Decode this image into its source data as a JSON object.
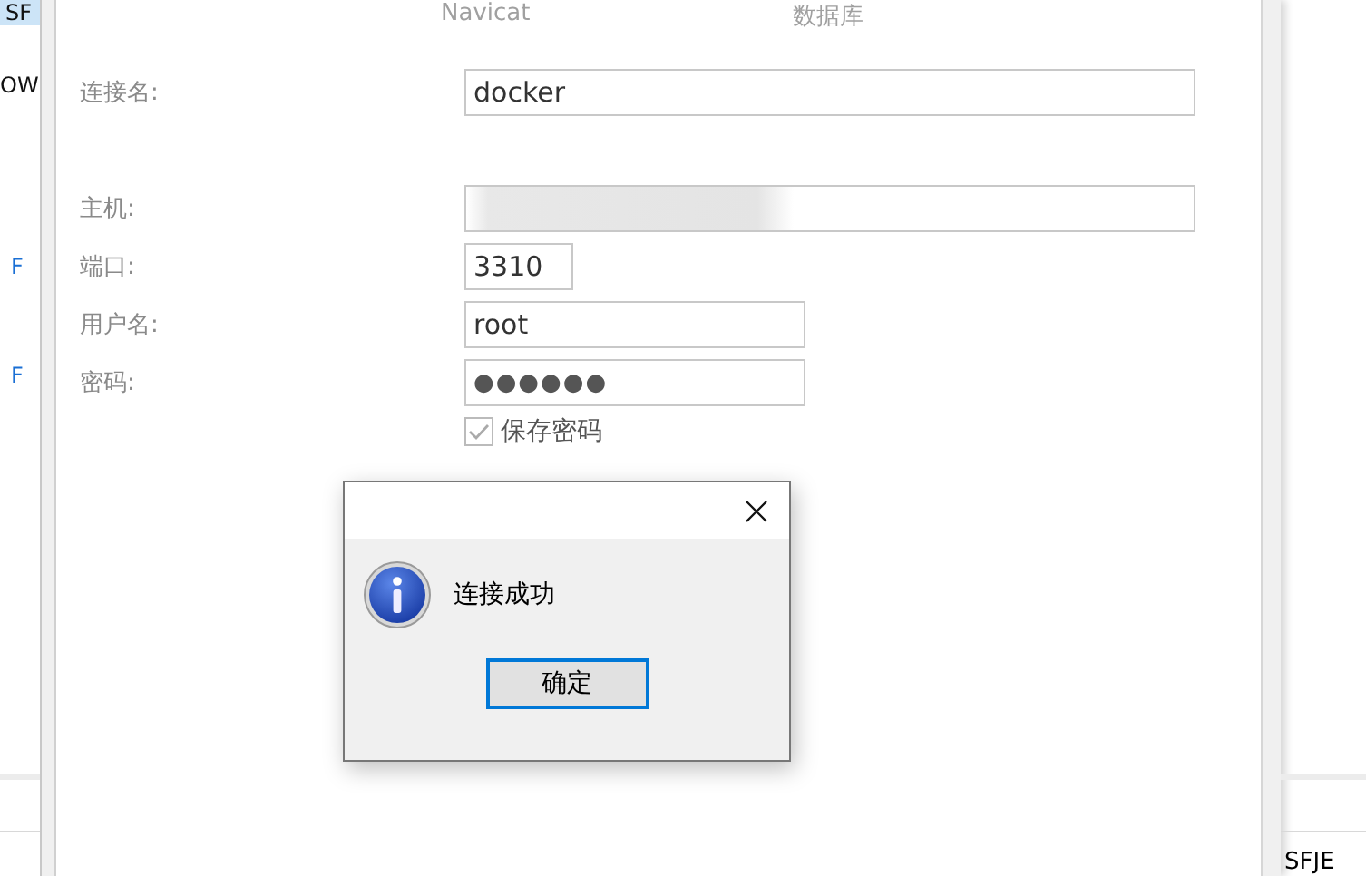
{
  "background_left": {
    "items": [
      {
        "text": "SF",
        "kind": "plain",
        "selected": true
      },
      {
        "text": "OW",
        "kind": "plain",
        "selected": false
      },
      {
        "text": "F",
        "kind": "link",
        "selected": false
      },
      {
        "text": "F",
        "kind": "link",
        "selected": false
      }
    ]
  },
  "background_right": {
    "items": [
      {
        "text": "SFJE"
      }
    ]
  },
  "connection_dialog": {
    "tabs": [
      {
        "label": "Navicat"
      },
      {
        "label": "数据库"
      }
    ],
    "fields": [
      {
        "label": "连接名:",
        "value": "docker",
        "kind": "text"
      },
      {
        "label": "主机:",
        "kind": "redacted"
      },
      {
        "label": "端口:",
        "value": "3310",
        "kind": "text"
      },
      {
        "label": "用户名:",
        "value": "root",
        "kind": "text"
      },
      {
        "label": "密码:",
        "value": "●●●●●●",
        "kind": "password"
      }
    ],
    "save_password": {
      "label": "保存密码",
      "checked": true,
      "disabled": true
    }
  },
  "message_box": {
    "message": "连接成功",
    "button": {
      "label": "确定",
      "focused": true
    }
  }
}
